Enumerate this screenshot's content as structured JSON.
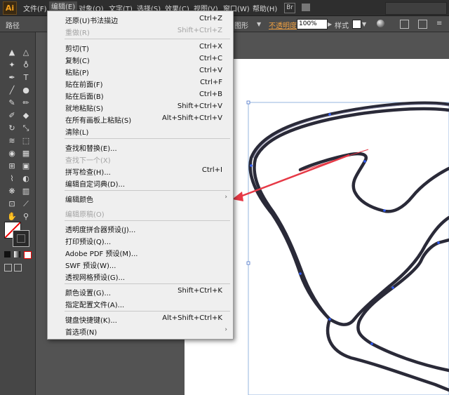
{
  "app": {
    "logo": "Ai"
  },
  "menubar": {
    "items": [
      "文件(F)",
      "编辑(E)",
      "对象(O)",
      "文字(T)",
      "选择(S)",
      "效果(C)",
      "视图(V)",
      "窗口(W)",
      "帮助(H)"
    ]
  },
  "controlbar": {
    "path_label": "路径",
    "style_partial": "图形",
    "opacity_label": "不透明度",
    "opacity_value": "100%",
    "style_label": "样式"
  },
  "edit_menu": {
    "items": [
      {
        "label": "还原(U)书法描边",
        "shortcut": "Ctrl+Z",
        "disabled": false
      },
      {
        "label": "重做(R)",
        "shortcut": "Shift+Ctrl+Z",
        "disabled": true
      },
      {
        "label": "剪切(T)",
        "shortcut": "Ctrl+X",
        "disabled": false
      },
      {
        "label": "复制(C)",
        "shortcut": "Ctrl+C",
        "disabled": false
      },
      {
        "label": "粘贴(P)",
        "shortcut": "Ctrl+V",
        "disabled": false
      },
      {
        "label": "贴在前面(F)",
        "shortcut": "Ctrl+F",
        "disabled": false
      },
      {
        "label": "贴在后面(B)",
        "shortcut": "Ctrl+B",
        "disabled": false
      },
      {
        "label": "就地粘贴(S)",
        "shortcut": "Shift+Ctrl+V",
        "disabled": false
      },
      {
        "label": "在所有画板上粘贴(S)",
        "shortcut": "Alt+Shift+Ctrl+V",
        "disabled": false
      },
      {
        "label": "清除(L)",
        "shortcut": "",
        "disabled": false
      },
      {
        "label": "查找和替换(E)...",
        "shortcut": "",
        "disabled": false
      },
      {
        "label": "查找下一个(X)",
        "shortcut": "",
        "disabled": true
      },
      {
        "label": "拼写检查(H)...",
        "shortcut": "Ctrl+I",
        "disabled": false
      },
      {
        "label": "编辑自定词典(D)...",
        "shortcut": "",
        "disabled": false
      },
      {
        "label": "编辑颜色",
        "shortcut": "",
        "disabled": false,
        "submenu": true
      },
      {
        "label": "编辑原稿(O)",
        "shortcut": "",
        "disabled": true
      },
      {
        "label": "透明度拼合器预设(J)...",
        "shortcut": "",
        "disabled": false
      },
      {
        "label": "打印预设(Q)...",
        "shortcut": "",
        "disabled": false
      },
      {
        "label": "Adobe PDF 预设(M)...",
        "shortcut": "",
        "disabled": false
      },
      {
        "label": "SWF 预设(W)...",
        "shortcut": "",
        "disabled": false
      },
      {
        "label": "透视网格预设(G)...",
        "shortcut": "",
        "disabled": false
      },
      {
        "label": "颜色设置(G)...",
        "shortcut": "Shift+Ctrl+K",
        "disabled": false
      },
      {
        "label": "指定配置文件(A)...",
        "shortcut": "",
        "disabled": false
      },
      {
        "label": "键盘快捷键(K)...",
        "shortcut": "Alt+Shift+Ctrl+K",
        "disabled": false
      },
      {
        "label": "首选项(N)",
        "shortcut": "",
        "disabled": false,
        "submenu": true
      }
    ],
    "submenu_arrow": "›"
  },
  "colors": {
    "menubar_bg": "#2e2e2e",
    "menu_bg": "#efefef",
    "annotation_arrow": "#e63946",
    "stroke": "#2a2a38",
    "anchor": "#2f5cff"
  },
  "icons": [
    "selection-tool-icon",
    "direct-selection-tool-icon",
    "magic-wand-icon",
    "lasso-icon",
    "pen-tool-icon",
    "type-tool-icon",
    "line-tool-icon",
    "rectangle-tool-icon",
    "paintbrush-icon",
    "pencil-icon",
    "blob-brush-icon",
    "eraser-icon",
    "rotate-icon",
    "scale-icon",
    "width-tool-icon",
    "free-transform-icon",
    "shape-builder-icon",
    "perspective-grid-icon",
    "mesh-icon",
    "gradient-icon",
    "eyedropper-icon",
    "blend-icon",
    "symbol-sprayer-icon",
    "column-graph-icon",
    "artboard-icon",
    "slice-icon",
    "hand-icon",
    "zoom-icon"
  ]
}
